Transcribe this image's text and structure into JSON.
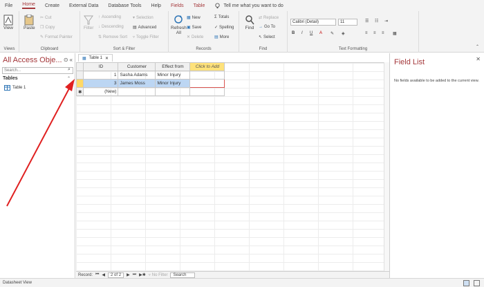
{
  "menu": {
    "tabs": [
      "File",
      "Home",
      "Create",
      "External Data",
      "Database Tools",
      "Help",
      "Fields",
      "Table"
    ],
    "active": "Home",
    "tell_me": "Tell me what you want to do"
  },
  "ribbon": {
    "views": {
      "label": "Views",
      "view_btn": "View"
    },
    "clipboard": {
      "label": "Clipboard",
      "paste": "Paste",
      "cut": "Cut",
      "copy": "Copy",
      "format_painter": "Format Painter"
    },
    "sort_filter": {
      "label": "Sort & Filter",
      "filter": "Filter",
      "ascending": "Ascending",
      "descending": "Descending",
      "remove_sort": "Remove Sort",
      "selection": "Selection",
      "advanced": "Advanced",
      "toggle_filter": "Toggle Filter"
    },
    "records": {
      "label": "Records",
      "refresh": "Refresh",
      "refresh_all": "All",
      "new": "New",
      "save": "Save",
      "delete": "Delete",
      "totals": "Totals",
      "spelling": "Spelling",
      "more": "More"
    },
    "find": {
      "label": "Find",
      "find": "Find",
      "replace": "Replace",
      "go_to": "Go To",
      "select": "Select"
    },
    "text_formatting": {
      "label": "Text Formatting",
      "font": "Calibri (Detail)",
      "size": "11"
    }
  },
  "nav": {
    "title": "All Access Obje...",
    "search_placeholder": "Search...",
    "section": "Tables",
    "items": [
      "Table 1"
    ]
  },
  "document": {
    "tab": "Table 1",
    "columns": [
      "ID",
      "Customer",
      "Effect from",
      "Click to Add"
    ],
    "rows": [
      {
        "id": "1",
        "customer": "Sasha Adams",
        "effect": "Minor Injury"
      },
      {
        "id": "3",
        "customer": "James Moss",
        "effect": "Minor Injury"
      }
    ],
    "new_row": "(New)",
    "record_nav": {
      "label": "Record:",
      "position": "2 of 2",
      "filter": "No Filter",
      "search": "Search"
    }
  },
  "field_list": {
    "title": "Field List",
    "text": "No fields available to be added to the current view."
  },
  "status": {
    "text": "Datasheet View"
  },
  "colors": {
    "accent": "#a4373a",
    "arrow": "#e02020"
  }
}
